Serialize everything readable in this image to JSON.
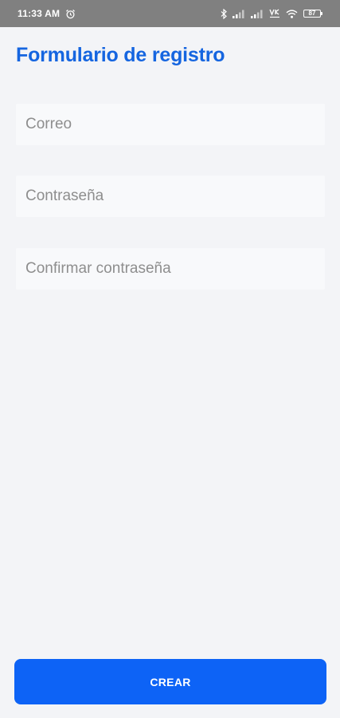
{
  "status_bar": {
    "time": "11:33 AM",
    "battery_level": "87",
    "icons": [
      "alarm-icon",
      "bluetooth-icon",
      "signal-icon",
      "signal-icon",
      "volte-icon",
      "wifi-icon",
      "battery-icon"
    ]
  },
  "form": {
    "title": "Formulario de registro",
    "email": {
      "placeholder": "Correo",
      "value": ""
    },
    "password": {
      "placeholder": "Contraseña",
      "value": ""
    },
    "confirm_password": {
      "placeholder": "Confirmar contraseña",
      "value": ""
    },
    "submit_label": "CREAR"
  },
  "colors": {
    "title": "#1565e0",
    "button": "#0d63f6",
    "background": "#f3f4f7",
    "status_bar": "#808080"
  }
}
